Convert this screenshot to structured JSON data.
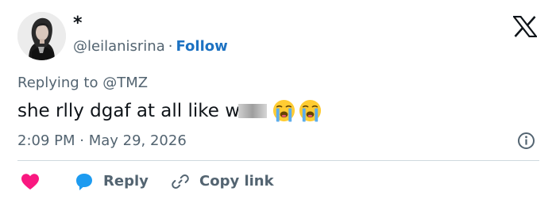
{
  "user": {
    "display_name": "*",
    "handle": "@leilanisrina",
    "separator": "·",
    "follow_label": "Follow"
  },
  "tweet": {
    "replying_prefix": "Replying to",
    "replying_to": "@TMZ",
    "text_visible": "she rlly dgaf at all like w",
    "censored": true,
    "emojis": [
      "loudly-crying-face",
      "loudly-crying-face"
    ],
    "timestamp": "2:09 PM · May 29, 2026"
  },
  "actions": {
    "like_icon": "heart-icon",
    "reply_label": "Reply",
    "copy_label": "Copy link"
  },
  "colors": {
    "like": "#f91880",
    "reply_bubble": "#1d9bf0",
    "follow": "#1d72c2",
    "secondary_text": "#536471"
  }
}
